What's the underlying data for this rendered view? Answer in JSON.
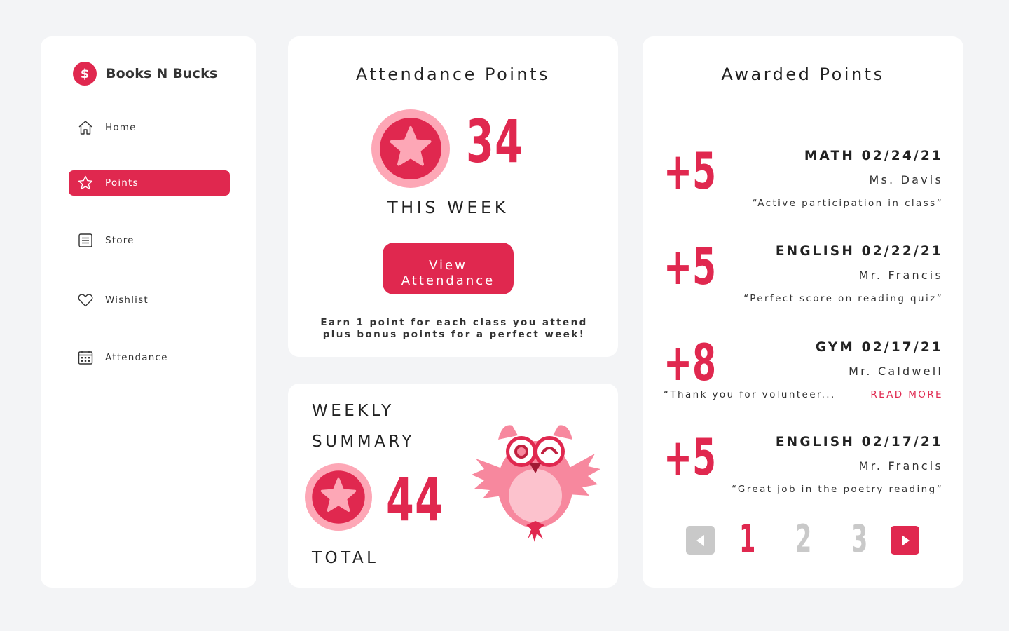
{
  "colors": {
    "accent": "#e0284f",
    "badge_outer": "#fda7b6",
    "owl_pink": "#f7889e",
    "inactive_grey": "#c9c9c9"
  },
  "brand": {
    "name": "Books N Bucks",
    "coin_symbol": "$"
  },
  "sidebar": {
    "items": [
      {
        "label": "Home",
        "icon": "home-icon",
        "active": false
      },
      {
        "label": "Points",
        "icon": "star-icon",
        "active": true
      },
      {
        "label": "Store",
        "icon": "list-icon",
        "active": false
      },
      {
        "label": "Wishlist",
        "icon": "heart-icon",
        "active": false
      },
      {
        "label": "Attendance",
        "icon": "calendar-icon",
        "active": false
      }
    ]
  },
  "attendance": {
    "title": "Attendance Points",
    "points": "34",
    "period": "THIS WEEK",
    "button_line1": "View",
    "button_line2": "Attendance",
    "note_line1": "Earn 1 point for each class you attend",
    "note_line2": "plus bonus points for a perfect week!"
  },
  "summary": {
    "title_line1": "WEEKLY",
    "title_line2": "SUMMARY",
    "points": "44",
    "label": "TOTAL"
  },
  "awarded": {
    "title": "Awarded Points",
    "items": [
      {
        "amount": "+5",
        "subject": "MATH 02/24/21",
        "teacher": "Ms. Davis",
        "comment": "“Active participation in class”"
      },
      {
        "amount": "+5",
        "subject": "ENGLISH 02/22/21",
        "teacher": "Mr. Francis",
        "comment": "“Perfect score on reading quiz”"
      },
      {
        "amount": "+8",
        "subject": "GYM 02/17/21",
        "teacher": "Mr. Caldwell",
        "comment": "“Thank you for volunteer...",
        "read_more": "READ MORE"
      },
      {
        "amount": "+5",
        "subject": "ENGLISH 02/17/21",
        "teacher": "Mr. Francis",
        "comment": "“Great job in the poetry reading”"
      }
    ],
    "pagination": {
      "pages": [
        "1",
        "2",
        "3"
      ],
      "current": 1
    }
  }
}
